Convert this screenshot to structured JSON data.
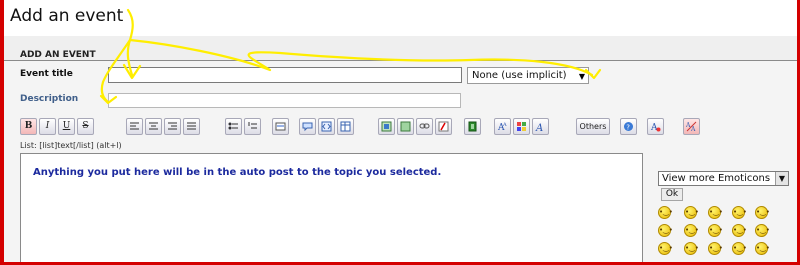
{
  "page": {
    "title": "Add an event"
  },
  "form": {
    "section_title": "ADD AN EVENT",
    "event_title_label": "Event title",
    "event_title_value": "",
    "visibility_select_value": "None (use implicit)",
    "description_label": "Description",
    "description_value": ""
  },
  "toolbar": {
    "buttons": [
      {
        "name": "bold-button",
        "icon": "bold-icon",
        "glyph": "B"
      },
      {
        "name": "italic-button",
        "icon": "italic-icon",
        "glyph": "I"
      },
      {
        "name": "underline-button",
        "icon": "underline-icon",
        "glyph": "U"
      },
      {
        "name": "strikethrough-button",
        "icon": "strikethrough-icon",
        "glyph": "S"
      },
      {
        "name": "align-left-button",
        "icon": "align-left-icon",
        "glyph": ""
      },
      {
        "name": "align-center-button",
        "icon": "align-center-icon",
        "glyph": ""
      },
      {
        "name": "align-right-button",
        "icon": "align-right-icon",
        "glyph": ""
      },
      {
        "name": "justify-button",
        "icon": "justify-icon",
        "glyph": ""
      },
      {
        "name": "bullet-list-button",
        "icon": "bullet-list-icon",
        "glyph": ""
      },
      {
        "name": "numbered-list-button",
        "icon": "numbered-list-icon",
        "glyph": ""
      },
      {
        "name": "horizontal-rule-button",
        "icon": "horizontal-rule-icon",
        "glyph": ""
      },
      {
        "name": "quote-button",
        "icon": "quote-icon",
        "glyph": ""
      },
      {
        "name": "code-button",
        "icon": "code-icon",
        "glyph": ""
      },
      {
        "name": "table-button",
        "icon": "table-icon",
        "glyph": ""
      },
      {
        "name": "image-button",
        "icon": "image-icon",
        "glyph": ""
      },
      {
        "name": "image-upload-button",
        "icon": "image-upload-icon",
        "glyph": ""
      },
      {
        "name": "link-button",
        "icon": "link-icon",
        "glyph": ""
      },
      {
        "name": "flash-button",
        "icon": "flash-icon",
        "glyph": ""
      },
      {
        "name": "video-button",
        "icon": "film-icon",
        "glyph": ""
      },
      {
        "name": "font-size-button",
        "icon": "font-size-icon",
        "glyph": ""
      },
      {
        "name": "color-button",
        "icon": "color-palette-icon",
        "glyph": ""
      },
      {
        "name": "font-button",
        "icon": "font-icon",
        "glyph": ""
      },
      {
        "name": "others-button",
        "icon": "others-icon",
        "glyph": "Others"
      },
      {
        "name": "help-button",
        "icon": "help-icon",
        "glyph": ""
      },
      {
        "name": "remove-format-button",
        "icon": "remove-format-icon",
        "glyph": ""
      },
      {
        "name": "toggle-mode-button",
        "icon": "toggle-mode-icon",
        "glyph": ""
      }
    ],
    "hint": "List: [list]text[/list] (alt+l)"
  },
  "editor": {
    "content": "Anything you put here will be in the auto post to the topic you selected."
  },
  "emoticons": {
    "select_value": "View more Emoticons",
    "ok_label": "Ok",
    "faces": [
      "laugh",
      "smile",
      "surprised",
      "sad",
      "eek",
      "cool",
      "rolleyes",
      "angry",
      "neutral",
      "sleepy",
      "confused",
      "evil",
      "mad",
      "wink",
      "embarrassed"
    ]
  },
  "colors": {
    "frame": "#d40000",
    "annotation": "#ffee00",
    "editor_text": "#1c2a9e",
    "description_label": "#405f8a"
  }
}
